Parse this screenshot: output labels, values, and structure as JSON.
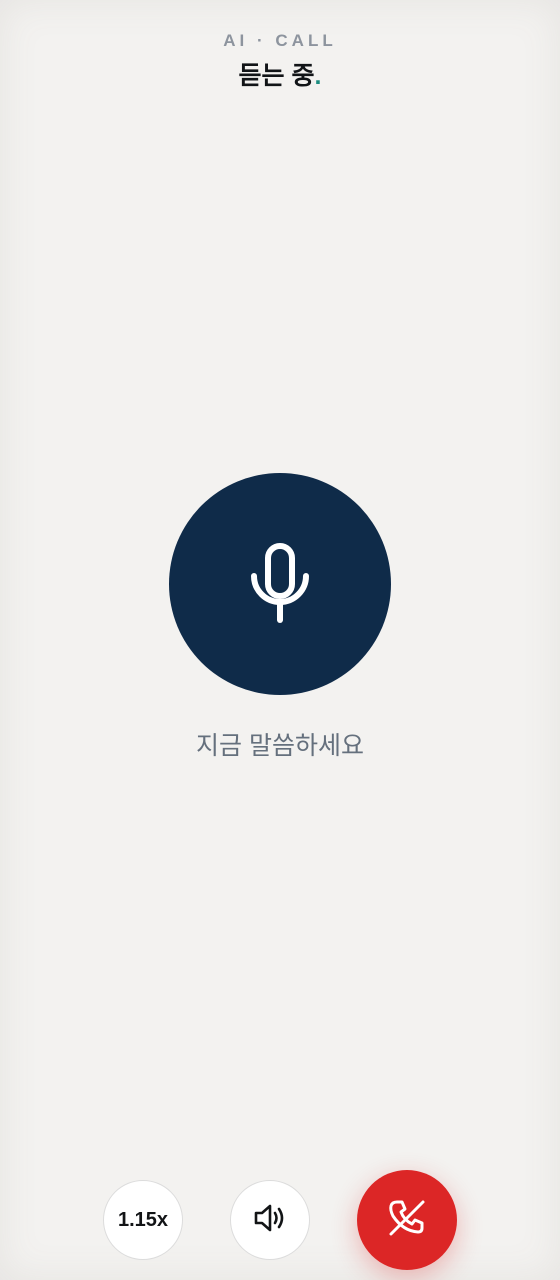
{
  "header": {
    "overline": "AI · CALL",
    "status_text": "듣는 중",
    "status_dot": "."
  },
  "main": {
    "mic_icon": "microphone-icon",
    "prompt": "지금 말씀하세요"
  },
  "controls": {
    "speed_label": "1.15x",
    "speaker_icon": "speaker-icon",
    "end_call_icon": "phone-off-icon"
  },
  "colors": {
    "background": "#f3f2f0",
    "mic_circle": "#0f2b49",
    "end_call": "#dc2626",
    "status_dot": "#1a8c7f",
    "prompt_text": "#65707d"
  }
}
